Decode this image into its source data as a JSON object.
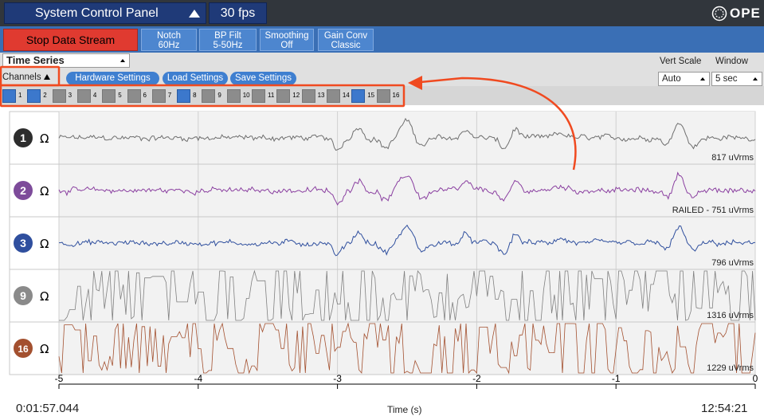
{
  "topbar": {
    "system_panel_label": "System Control Panel",
    "fps_label": "30 fps",
    "logo_text": "OPE"
  },
  "controls": {
    "stop_label": "Stop Data Stream",
    "buttons": [
      {
        "line1": "Notch",
        "line2": "60Hz"
      },
      {
        "line1": "BP Filt",
        "line2": "5-50Hz"
      },
      {
        "line1": "Smoothing",
        "line2": "Off"
      },
      {
        "line1": "Gain Conv",
        "line2": "Classic"
      }
    ]
  },
  "widget": {
    "title": "Time Series",
    "vert_scale_label": "Vert Scale",
    "window_label": "Window",
    "vert_scale_value": "Auto",
    "window_value": "5 sec",
    "channels_label": "Channels",
    "hardware_settings": "Hardware Settings",
    "load_settings": "Load Settings",
    "save_settings": "Save Settings"
  },
  "channel_selector": [
    {
      "num": "1",
      "on": true
    },
    {
      "num": "2",
      "on": true
    },
    {
      "num": "3",
      "on": false
    },
    {
      "num": "4",
      "on": false
    },
    {
      "num": "5",
      "on": false
    },
    {
      "num": "6",
      "on": false
    },
    {
      "num": "7",
      "on": false
    },
    {
      "num": "8",
      "on": true
    },
    {
      "num": "9",
      "on": false
    },
    {
      "num": "10",
      "on": false
    },
    {
      "num": "11",
      "on": false
    },
    {
      "num": "12",
      "on": false
    },
    {
      "num": "13",
      "on": false
    },
    {
      "num": "14",
      "on": false
    },
    {
      "num": "15",
      "on": true
    },
    {
      "num": "16",
      "on": false
    }
  ],
  "channels": [
    {
      "id": "1",
      "color": "#2d2d2d",
      "trace": "#6e6e6e",
      "ohm": "Ω",
      "rms": "817 uVrms",
      "kind": "eeg"
    },
    {
      "id": "2",
      "color": "#7d4b9a",
      "trace": "#8a3fa0",
      "ohm": "Ω",
      "rms": "RAILED - 751 uVrms",
      "kind": "eeg"
    },
    {
      "id": "3",
      "color": "#2f4f9e",
      "trace": "#2f4f9e",
      "ohm": "Ω",
      "rms": "796 uVrms",
      "kind": "eeg"
    },
    {
      "id": "9",
      "color": "#8a8a8a",
      "trace": "#808080",
      "ohm": "Ω",
      "rms": "1316 uVrms",
      "kind": "noise"
    },
    {
      "id": "16",
      "color": "#a3502f",
      "trace": "#a3502f",
      "ohm": "Ω",
      "rms": "1229 uVrms",
      "kind": "noise"
    }
  ],
  "x_axis": {
    "ticks": [
      "-5",
      "-4",
      "-3",
      "-2",
      "-1",
      "0"
    ],
    "label": "Time (s)"
  },
  "footer": {
    "elapsed": "0:01:57.044",
    "clock": "12:54:21"
  },
  "colors": {
    "topbar": "#31363c",
    "control_row": "#3a6fb5",
    "stop_button": "#e03a30",
    "annotation": "#f04a20"
  }
}
